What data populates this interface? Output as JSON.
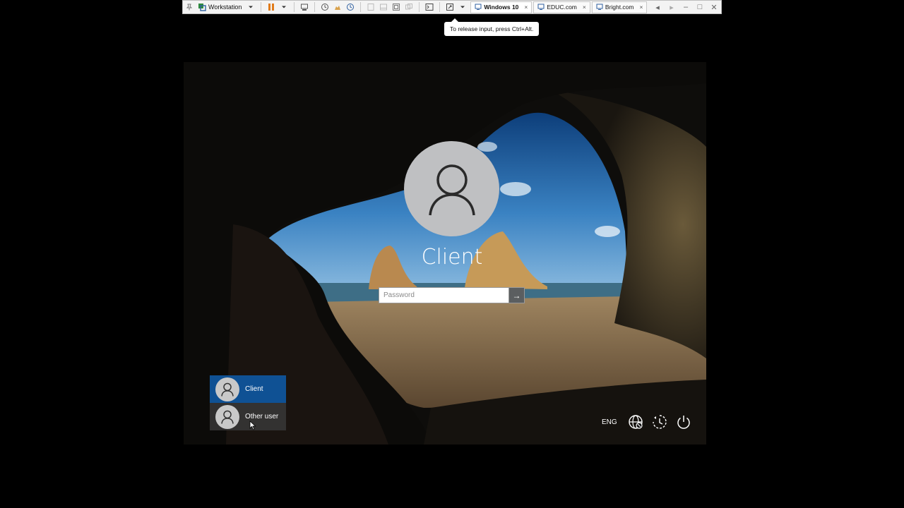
{
  "toolbar": {
    "product_label": "Workstation",
    "tabs": [
      {
        "label": "Windows 10",
        "active": true
      },
      {
        "label": "EDUC.com",
        "active": false
      },
      {
        "label": "Bright.com",
        "active": false
      }
    ],
    "tab_close_glyph": "×"
  },
  "tooltip": {
    "text": "To release input, press Ctrl+Alt."
  },
  "lock_screen": {
    "user_name": "Client",
    "password_placeholder": "Password",
    "submit_glyph": "→",
    "users": [
      {
        "name": "Client",
        "selected": true
      },
      {
        "name": "Other user",
        "selected": false
      }
    ],
    "language": "ENG",
    "icons": [
      "network-icon",
      "ease-of-access-icon",
      "power-icon"
    ]
  },
  "colors": {
    "selected_user": "#0f5194",
    "toolbar_bg": "#f3f3f3"
  }
}
